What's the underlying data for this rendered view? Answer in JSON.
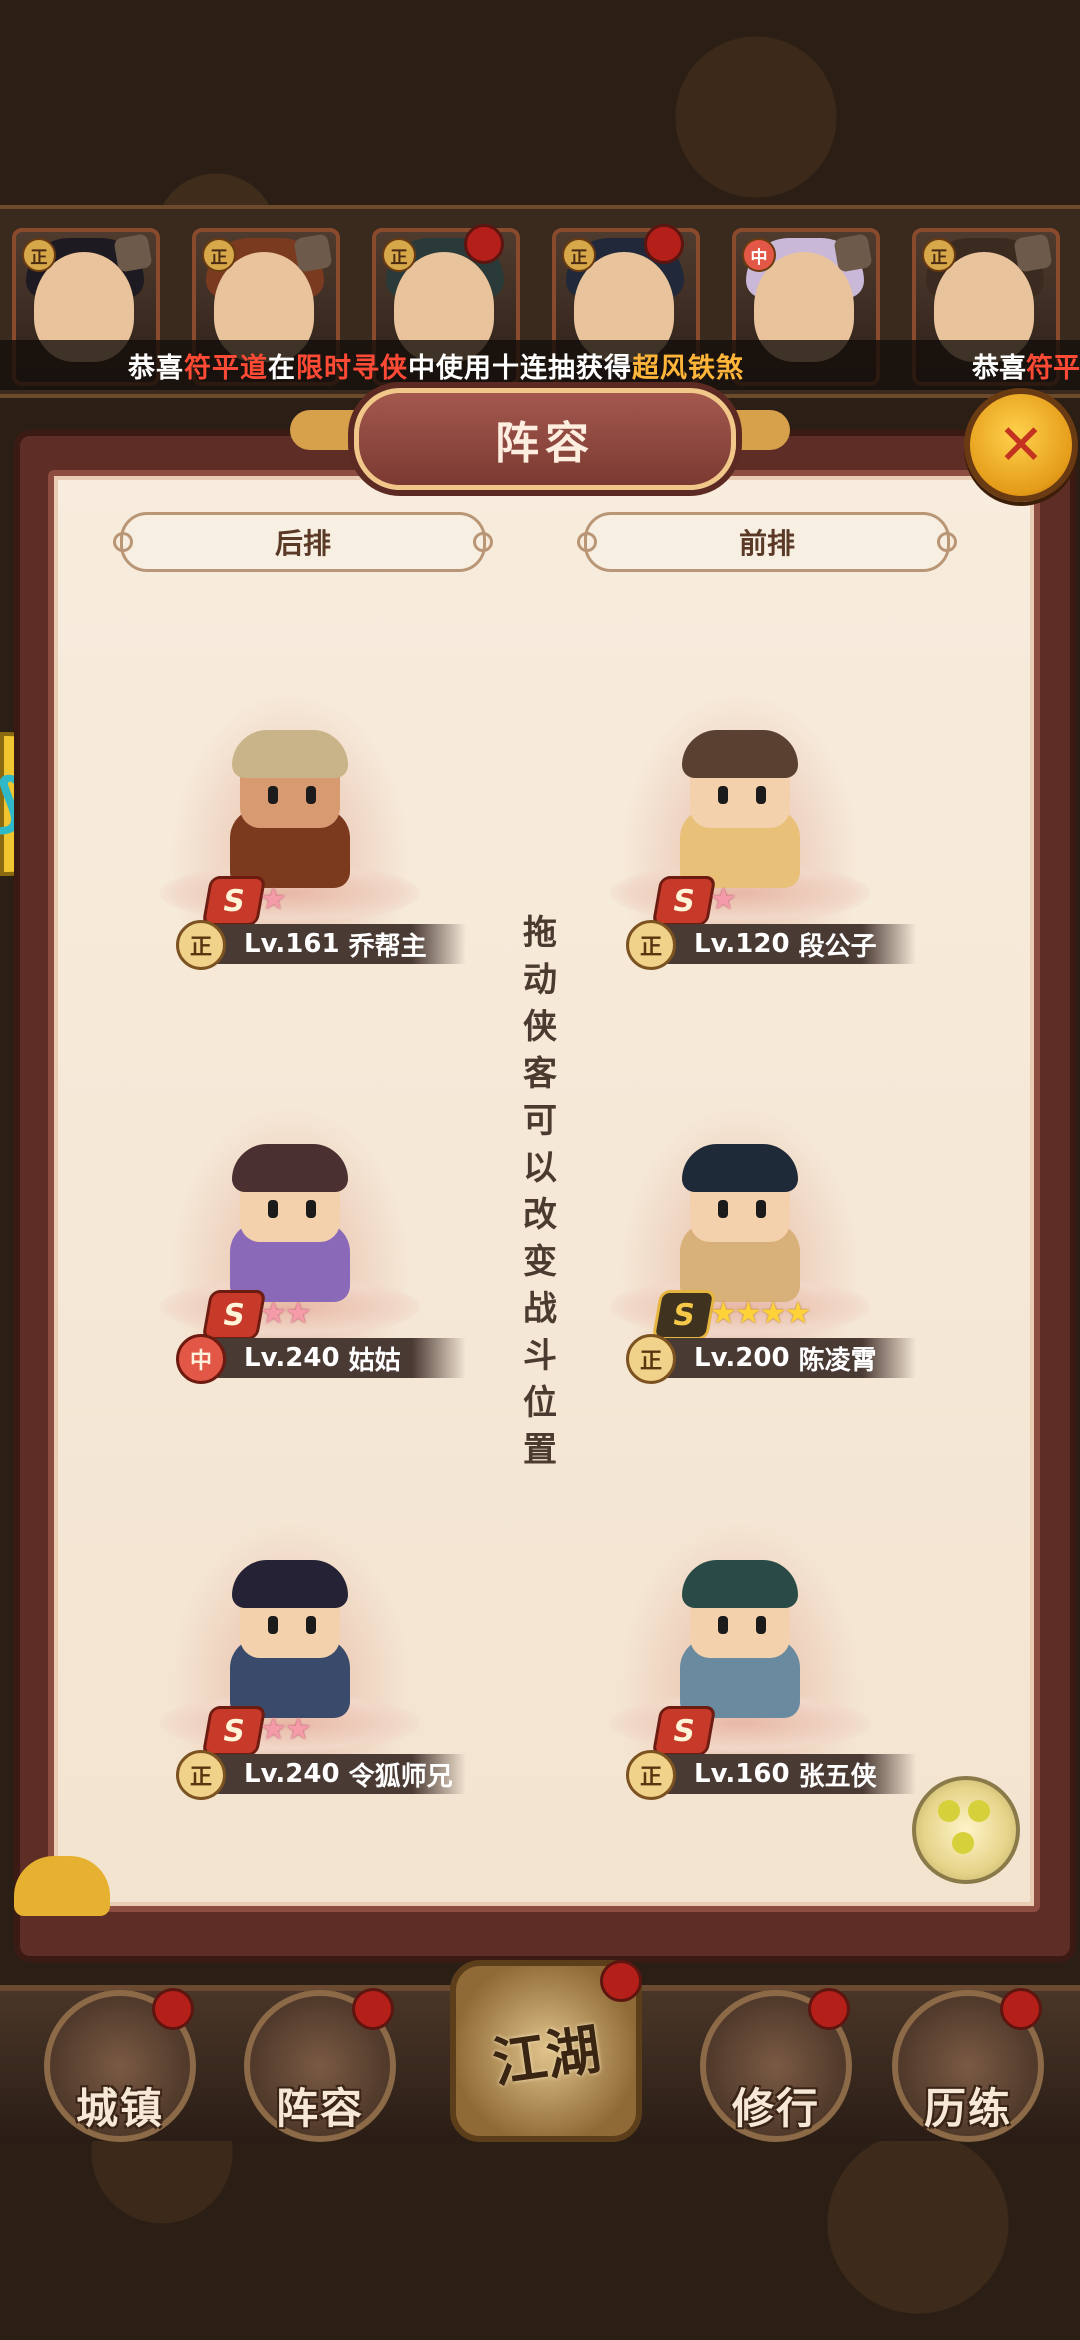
{
  "marquee": {
    "prefix": "恭喜",
    "player": "符平道",
    "mid1": "在",
    "event": "限时寻侠",
    "mid2": "中使用十连抽获得",
    "reward": "超风铁煞",
    "repeat_prefix": "恭喜",
    "repeat_player": "符平"
  },
  "top_heroes": [
    {
      "faction": "正"
    },
    {
      "faction": "正"
    },
    {
      "faction": "正"
    },
    {
      "faction": "正"
    },
    {
      "faction": "中"
    },
    {
      "faction": "正"
    }
  ],
  "panel": {
    "title": "阵容",
    "back_row_label": "后排",
    "front_row_label": "前排",
    "hint": "拖动侠客可以改变战斗位置"
  },
  "heroes": [
    {
      "faction": "正",
      "level": "Lv.161",
      "name": "乔帮主",
      "rank": "S",
      "stars": "★",
      "star_color": "pink"
    },
    {
      "faction": "正",
      "level": "Lv.120",
      "name": "段公子",
      "rank": "S",
      "stars": "★",
      "star_color": "pink"
    },
    {
      "faction": "中",
      "level": "Lv.240",
      "name": "姑姑",
      "rank": "S",
      "stars": "★★",
      "star_color": "pink"
    },
    {
      "faction": "正",
      "level": "Lv.200",
      "name": "陈凌霄",
      "rank": "S",
      "stars": "★★★★",
      "star_color": "gold"
    },
    {
      "faction": "正",
      "level": "Lv.240",
      "name": "令狐师兄",
      "rank": "S",
      "stars": "★★",
      "star_color": "pink"
    },
    {
      "faction": "正",
      "level": "Lv.160",
      "name": "张五侠",
      "rank": "S",
      "stars": "",
      "star_color": "pink"
    }
  ],
  "nav": {
    "town": "城镇",
    "lineup": "阵容",
    "jianghu": "江湖",
    "practice": "修行",
    "trial": "历练"
  },
  "colors": {
    "accent_red": "#ff4a36",
    "accent_orange": "#ffb53a",
    "panel_bg": "#f7ecdd",
    "frame": "#8d4c40"
  },
  "icons": {
    "close": "close-icon",
    "chat": "chat-icon"
  }
}
